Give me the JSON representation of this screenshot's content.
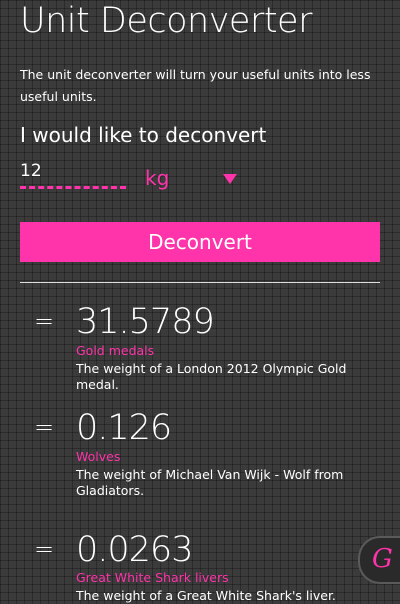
{
  "header": {
    "title": "Unit Deconverter"
  },
  "intro": {
    "text": "The unit deconverter will turn your useful units into less useful units."
  },
  "form": {
    "prompt": "I would like to deconvert",
    "quantity_value": "12",
    "unit_selected": "kg",
    "button_label": "Deconvert"
  },
  "results": [
    {
      "equals": "=",
      "value": "31.5789",
      "unit": "Gold medals",
      "description": "The weight of a London 2012 Olympic Gold medal."
    },
    {
      "equals": "=",
      "value": "0.126",
      "unit": "Wolves",
      "description": "The weight of Michael Van Wijk - Wolf from Gladiators."
    },
    {
      "equals": "=",
      "value": "0.0263",
      "unit": "Great White Shark livers",
      "description": "The weight of a Great White Shark's liver."
    }
  ],
  "badge": {
    "glyph": "G",
    "icon": "g-logo-icon"
  },
  "colors": {
    "accent": "#ff33aa",
    "background": "#3b3b3b",
    "text": "#ffffff"
  }
}
